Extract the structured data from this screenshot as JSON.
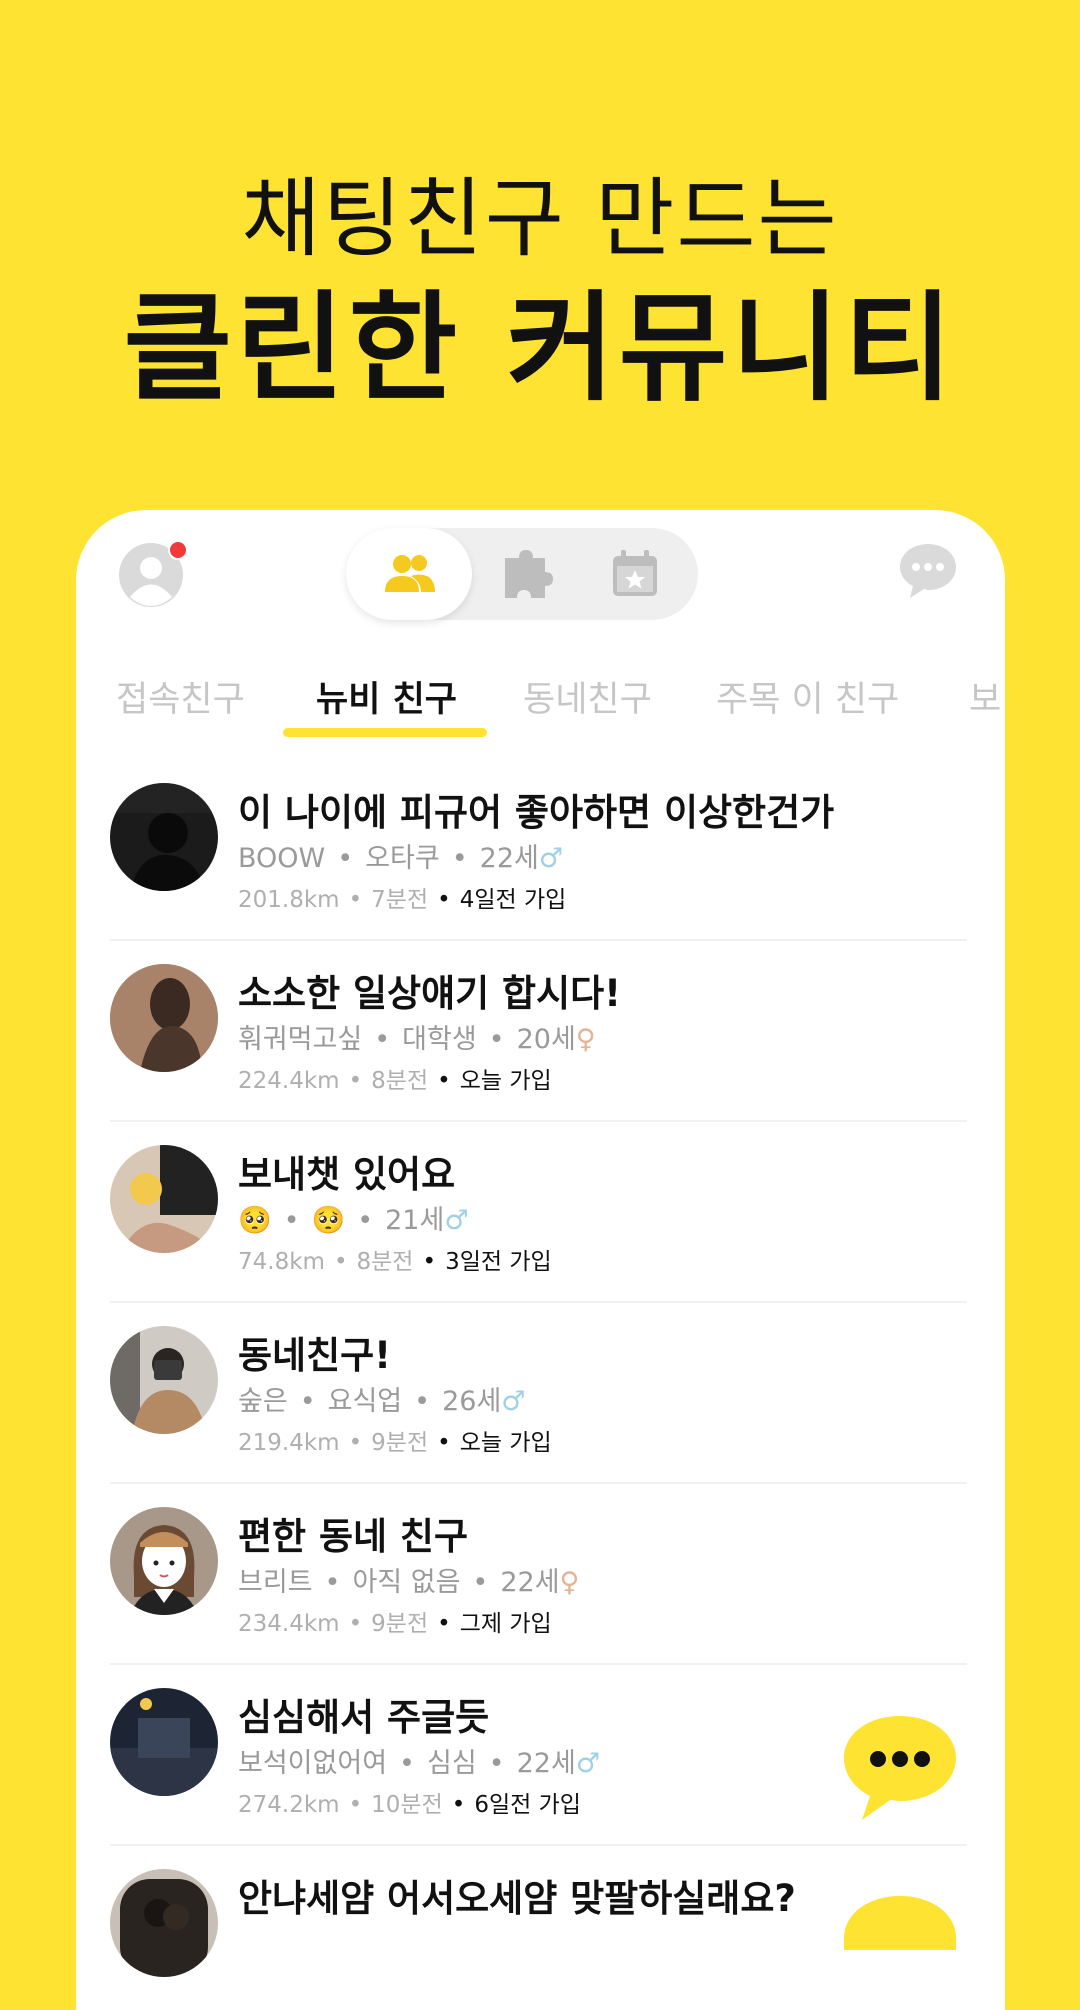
{
  "hero": {
    "line1": "채팅친구 만드는",
    "line2": "클린한 커뮤니티"
  },
  "tabs": [
    {
      "label": "접속친구",
      "active": false
    },
    {
      "label": "뉴비 친구",
      "active": true
    },
    {
      "label": "동네친구",
      "active": false
    },
    {
      "label": "주목 이 친구",
      "active": false
    },
    {
      "label": "보",
      "active": false
    }
  ],
  "colors": {
    "brand_yellow": "#FEE332",
    "notification": "#F1393A",
    "male": "#9FD0E6",
    "female": "#E2B493"
  },
  "icons": {
    "profile": "profile-icon",
    "friends": "friends-icon",
    "puzzle": "puzzle-icon",
    "calendar": "calendar-star-icon",
    "chat": "chat-bubble-icon",
    "more": "more-chat-icon"
  },
  "posts": [
    {
      "title": "이 나이에 피규어 좋아하면 이상한건가",
      "nickname": "BOOW",
      "job": "오타쿠",
      "age": "22세",
      "gender": "♂",
      "gender_type": "male",
      "distance": "201.8km",
      "time": "7분전",
      "joined": "4일전 가입"
    },
    {
      "title": "소소한 일상얘기 합시다!",
      "nickname": "훠궈먹고싶",
      "job": "대학생",
      "age": "20세",
      "gender": "♀",
      "gender_type": "female",
      "distance": "224.4km",
      "time": "8분전",
      "joined": "오늘 가입"
    },
    {
      "title": "보내챗 있어요",
      "nickname": "🥺",
      "job": "🥺",
      "age": "21세",
      "gender": "♂",
      "gender_type": "male",
      "distance": "74.8km",
      "time": "8분전",
      "joined": "3일전 가입"
    },
    {
      "title": "동네친구!",
      "nickname": "숲은",
      "job": "요식업",
      "age": "26세",
      "gender": "♂",
      "gender_type": "male",
      "distance": "219.4km",
      "time": "9분전",
      "joined": "오늘 가입"
    },
    {
      "title": "편한 동네 친구",
      "nickname": "브리트",
      "job": "아직 없음",
      "age": "22세",
      "gender": "♀",
      "gender_type": "female",
      "distance": "234.4km",
      "time": "9분전",
      "joined": "그제 가입"
    },
    {
      "title": "심심해서 주글듯",
      "nickname": "보석이없어여",
      "job": "심심",
      "age": "22세",
      "gender": "♂",
      "gender_type": "male",
      "distance": "274.2km",
      "time": "10분전",
      "joined": "6일전 가입"
    },
    {
      "title": "안냐세얌 어서오세얌 맞팔하실래요?",
      "nickname": "",
      "job": "",
      "age": "",
      "gender": "",
      "gender_type": "male",
      "distance": "",
      "time": "",
      "joined": ""
    }
  ]
}
